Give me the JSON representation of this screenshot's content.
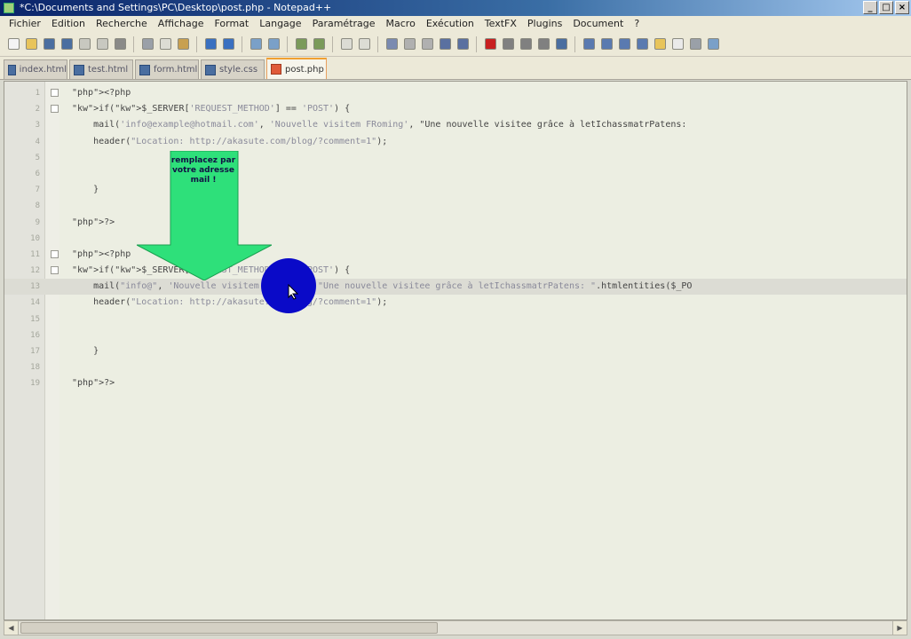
{
  "window": {
    "title": "*C:\\Documents and Settings\\PC\\Desktop\\post.php - Notepad++"
  },
  "menu": {
    "items": [
      "Fichier",
      "Edition",
      "Recherche",
      "Affichage",
      "Format",
      "Langage",
      "Paramétrage",
      "Macro",
      "Exécution",
      "TextFX",
      "Plugins",
      "Document",
      "?"
    ]
  },
  "tabs": [
    {
      "label": "index.html",
      "active": false
    },
    {
      "label": "test.html",
      "active": false
    },
    {
      "label": "form.html",
      "active": false
    },
    {
      "label": "style.css",
      "active": false
    },
    {
      "label": "post.php",
      "active": true
    }
  ],
  "editor": {
    "lines": [
      {
        "n": "1",
        "text": "<?php",
        "fold": true
      },
      {
        "n": "2",
        "text": "if($_SERVER['REQUEST_METHOD'] == 'POST') {",
        "fold": true
      },
      {
        "n": "3",
        "text": "    mail('info@example@hotmail.com', 'Nouvelle visitem FRoming', \"Une nouvelle visitee grâce à letIchassmatrPatens:"
      },
      {
        "n": "4",
        "text": "    header(\"Location: http://akasute.com/blog/?comment=1\");"
      },
      {
        "n": "5",
        "text": ""
      },
      {
        "n": "6",
        "text": ""
      },
      {
        "n": "7",
        "text": "    }"
      },
      {
        "n": "8",
        "text": ""
      },
      {
        "n": "9",
        "text": "?>"
      },
      {
        "n": "10",
        "text": ""
      },
      {
        "n": "11",
        "text": "<?php",
        "fold": true
      },
      {
        "n": "12",
        "text": "if($_SERVER['REQUEST_METHOD'] == 'POST') {",
        "fold": true
      },
      {
        "n": "13",
        "text": "    mail(\"info@\", 'Nouvelle visitem FRoming', \"Une nouvelle visitee grâce à letIchassmatrPatens: \".htmlentities($_PO",
        "current": true
      },
      {
        "n": "14",
        "text": "    header(\"Location: http://akasute.com/blog/?comment=1\");"
      },
      {
        "n": "15",
        "text": ""
      },
      {
        "n": "16",
        "text": ""
      },
      {
        "n": "17",
        "text": "    }"
      },
      {
        "n": "18",
        "text": ""
      },
      {
        "n": "19",
        "text": "?>"
      }
    ]
  },
  "annotation": {
    "text": "remplacez par votre adresse mail !",
    "arrow_color": "#2ee07a"
  },
  "colors": {
    "php_tag": "#e0603a",
    "keyword": "#1a1aa0",
    "cursor_highlight": "#0a0ac8"
  }
}
